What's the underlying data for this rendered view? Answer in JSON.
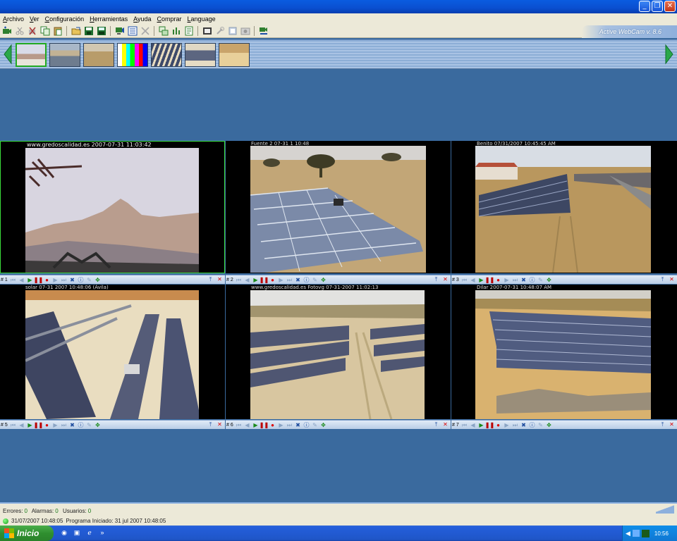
{
  "window": {
    "title": "",
    "controls": [
      "minimize",
      "restore",
      "close"
    ]
  },
  "menu": [
    "Archivo",
    "Ver",
    "Configuración",
    "Herramientas",
    "Ayuda",
    "Comprar",
    "Language"
  ],
  "toolbar": {
    "brand": "Active WebCam v. 8.6",
    "icons": [
      "add-camera-icon",
      "cut-icon",
      "delete-icon",
      "copy-icon",
      "paste-icon",
      "open-icon",
      "save-icon",
      "save-all-icon",
      "monitor-icon",
      "list-icon",
      "resize-icon",
      "cascade-icon",
      "tile-icon",
      "properties-icon",
      "film-icon",
      "tools-icon",
      "settings-icon",
      "snapshot-icon",
      "broadcast-icon"
    ]
  },
  "thumbnails": [
    {
      "name": "mountain",
      "selected": true
    },
    {
      "name": "panels-far",
      "selected": false
    },
    {
      "name": "field",
      "selected": false
    },
    {
      "name": "color-bars",
      "selected": false
    },
    {
      "name": "panels-rows",
      "selected": false
    },
    {
      "name": "panels-slope",
      "selected": false
    },
    {
      "name": "panels-close",
      "selected": false
    }
  ],
  "cameras": [
    {
      "num": "# 1",
      "overlay": "www.gredoscalidad.es 2007-07-31 11:03:42",
      "scene": "mountain",
      "selected": true
    },
    {
      "num": "# 2",
      "overlay": "Fuente 2 07-31 1 10:48",
      "scene": "panels-tree",
      "selected": false
    },
    {
      "num": "# 3",
      "overlay": "Benito 07/31/2007 10:45:45 AM",
      "scene": "farm",
      "selected": false
    },
    {
      "num": "# 5",
      "overlay": "solar 07-31 2007 10:48:06 (Ávila)",
      "scene": "rows-close",
      "selected": false
    },
    {
      "num": "# 6",
      "overlay": "www.gredoscalidad.es Fotovg 07-31-2007 11:02:13",
      "scene": "rows-far",
      "selected": false
    },
    {
      "num": "# 7",
      "overlay": "Dilar 2007-07-31 10:48:07 AM",
      "scene": "panels-stones",
      "selected": false
    }
  ],
  "status": {
    "errores_label": "Errores:",
    "errores": "0",
    "alarmas_label": "Alarmas:",
    "alarmas": "0",
    "usuarios_label": "Usuarios:",
    "usuarios": "0",
    "timestamp": "31/07/2007 10:48:05",
    "message": "Programa Iniciado: 31 jul 2007 10:48:05"
  },
  "taskbar": {
    "start_label": "Inicio",
    "clock": "10:56"
  },
  "colors": {
    "desktop": "#3a6a9e",
    "panel_bg": "#000000",
    "selected_border": "#3bdd3b",
    "taskbar": "#245edb",
    "start": "#2f8f2f"
  }
}
